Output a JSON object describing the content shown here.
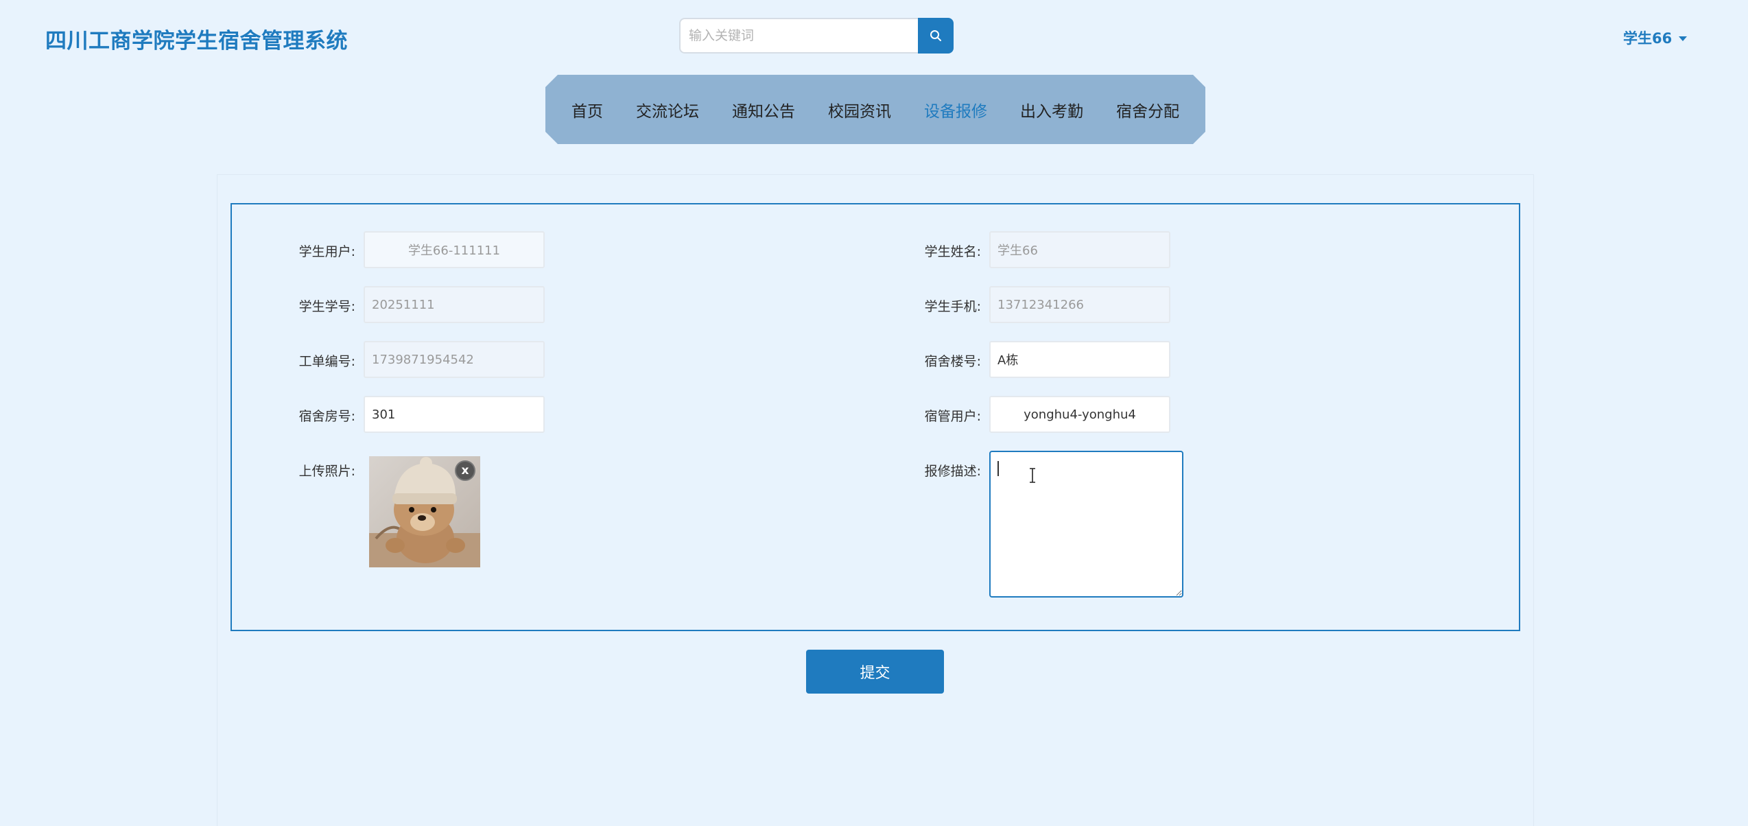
{
  "header": {
    "site_title": "四川工商学院学生宿舍管理系统",
    "search_placeholder": "输入关键词",
    "user_name": "学生66"
  },
  "nav": {
    "items": [
      {
        "label": "首页",
        "active": false
      },
      {
        "label": "交流论坛",
        "active": false
      },
      {
        "label": "通知公告",
        "active": false
      },
      {
        "label": "校园资讯",
        "active": false
      },
      {
        "label": "设备报修",
        "active": true
      },
      {
        "label": "出入考勤",
        "active": false
      },
      {
        "label": "宿舍分配",
        "active": false
      }
    ]
  },
  "form": {
    "student_user": {
      "label": "学生用户:",
      "value": "学生66-111111"
    },
    "student_name": {
      "label": "学生姓名:",
      "value": "学生66"
    },
    "student_id": {
      "label": "学生学号:",
      "value": "20251111"
    },
    "student_phone": {
      "label": "学生手机:",
      "value": "13712341266"
    },
    "ticket_no": {
      "label": "工单编号:",
      "value": "1739871954542"
    },
    "building_no": {
      "label": "宿舍楼号:",
      "value": "A栋"
    },
    "room_no": {
      "label": "宿舍房号:",
      "value": "301"
    },
    "manager_user": {
      "label": "宿管用户:",
      "value": "yonghu4-yonghu4"
    },
    "upload_photo": {
      "label": "上传照片:",
      "remove_label": "x"
    },
    "repair_desc": {
      "label": "报修描述:",
      "value": ""
    },
    "submit_label": "提交"
  },
  "colors": {
    "accent": "#1f7bbf",
    "nav_bg": "#8fb2d2",
    "page_bg": "#e8f3fd"
  }
}
